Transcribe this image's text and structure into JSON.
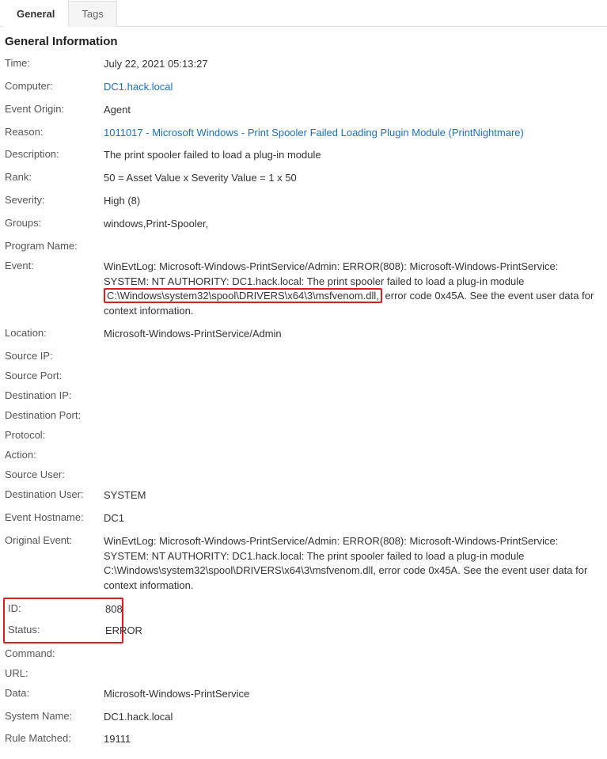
{
  "tabs": {
    "general": "General",
    "tags": "Tags"
  },
  "section_title": "General Information",
  "labels": {
    "time": "Time:",
    "computer": "Computer:",
    "event_origin": "Event Origin:",
    "reason": "Reason:",
    "description": "Description:",
    "rank": "Rank:",
    "severity": "Severity:",
    "groups": "Groups:",
    "program_name": "Program Name:",
    "event": "Event:",
    "location": "Location:",
    "source_ip": "Source IP:",
    "source_port": "Source Port:",
    "destination_ip": "Destination IP:",
    "destination_port": "Destination Port:",
    "protocol": "Protocol:",
    "action": "Action:",
    "source_user": "Source User:",
    "destination_user": "Destination User:",
    "event_hostname": "Event Hostname:",
    "original_event": "Original Event:",
    "id": "ID:",
    "status": "Status:",
    "command": "Command:",
    "url": "URL:",
    "data": "Data:",
    "system_name": "System Name:",
    "rule_matched": "Rule Matched:"
  },
  "values": {
    "time": "July 22, 2021 05:13:27",
    "computer": "DC1.hack.local",
    "event_origin": "Agent",
    "reason": "1011017 - Microsoft Windows - Print Spooler Failed Loading Plugin Module (PrintNightmare)",
    "description": "The print spooler failed to load a plug-in module",
    "rank": "50 = Asset Value x Severity Value = 1 x 50",
    "severity": "High (8)",
    "groups": "windows,Print-Spooler,",
    "program_name": "",
    "event_pre": "WinEvtLog: Microsoft-Windows-PrintService/Admin: ERROR(808): Microsoft-Windows-PrintService: SYSTEM: NT AUTHORITY: DC1.hack.local: The print spooler failed to load a plug-in module ",
    "event_highlight": "C:\\Windows\\system32\\spool\\DRIVERS\\x64\\3\\msfvenom.dll,",
    "event_post": " error code 0x45A. See the event user data for context information.",
    "location": "Microsoft-Windows-PrintService/Admin",
    "source_ip": "",
    "source_port": "",
    "destination_ip": "",
    "destination_port": "",
    "protocol": "",
    "action": "",
    "source_user": "",
    "destination_user": "SYSTEM",
    "event_hostname": "DC1",
    "original_event": "WinEvtLog: Microsoft-Windows-PrintService/Admin: ERROR(808): Microsoft-Windows-PrintService: SYSTEM: NT AUTHORITY: DC1.hack.local: The print spooler failed to load a plug-in module C:\\Windows\\system32\\spool\\DRIVERS\\x64\\3\\msfvenom.dll, error code 0x45A. See the event user data for context information.",
    "id": "808",
    "status": "ERROR",
    "command": "",
    "url": "",
    "data": "Microsoft-Windows-PrintService",
    "system_name": "DC1.hack.local",
    "rule_matched": "19111"
  }
}
